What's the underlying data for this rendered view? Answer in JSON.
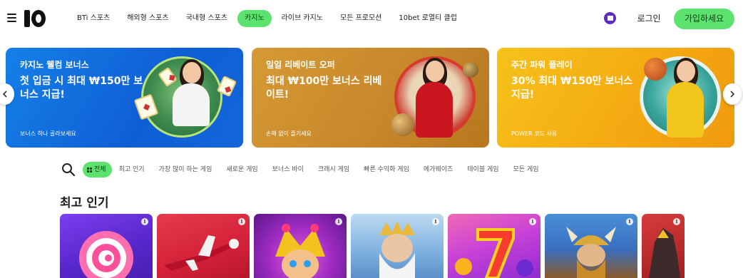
{
  "header": {
    "nav": [
      {
        "label": "BTi 스포츠",
        "active": false
      },
      {
        "label": "해외형 스포츠",
        "active": false
      },
      {
        "label": "국내형 스포츠",
        "active": false
      },
      {
        "label": "카지노",
        "active": true
      },
      {
        "label": "라이브 카지노",
        "active": false
      },
      {
        "label": "모든 프로모션",
        "active": false
      },
      {
        "label": "10bet 로열티 클럽",
        "active": false
      }
    ],
    "login_label": "로그인",
    "join_label": "가입하세요"
  },
  "banners": [
    {
      "title": "카지노 웰컴 보너스",
      "headline": "첫 입금 시 최대 ₩150만 보너스 지급!",
      "cta": "보너스 하나 골라보세요"
    },
    {
      "title": "일일 리베이트 오퍼",
      "headline": "최대 ₩100만 보너스 리베이트!",
      "cta": "손해 없이 즐기세요"
    },
    {
      "title": "주간 파워 플레이",
      "headline": "30% 최대 ₩150만 보너스 지급!",
      "cta": "POWER 코드 사용"
    }
  ],
  "categories": [
    {
      "label": "전체",
      "active": true
    },
    {
      "label": "최고 인기",
      "active": false
    },
    {
      "label": "가장 많이 하는 게임",
      "active": false
    },
    {
      "label": "새로운 게임",
      "active": false
    },
    {
      "label": "보너스 바이",
      "active": false
    },
    {
      "label": "크래시 게임",
      "active": false
    },
    {
      "label": "빠른 수익화 게임",
      "active": false
    },
    {
      "label": "메가웨이즈",
      "active": false
    },
    {
      "label": "테이블 게임",
      "active": false
    },
    {
      "label": "모든 게임",
      "active": false
    }
  ],
  "section": {
    "title": "최고 인기"
  },
  "games": [
    {
      "icon": "candy-swirl"
    },
    {
      "icon": "airplane"
    },
    {
      "icon": "jester"
    },
    {
      "icon": "zeus"
    },
    {
      "icon": "lucky-seven"
    },
    {
      "icon": "viking-warrior"
    },
    {
      "icon": "dragon"
    }
  ],
  "colors": {
    "accent": "#5ce36f",
    "banner_blue": "#1580e8",
    "banner_gold": "#d59a34",
    "banner_yellow": "#f7c21a"
  },
  "info_glyph": "i"
}
